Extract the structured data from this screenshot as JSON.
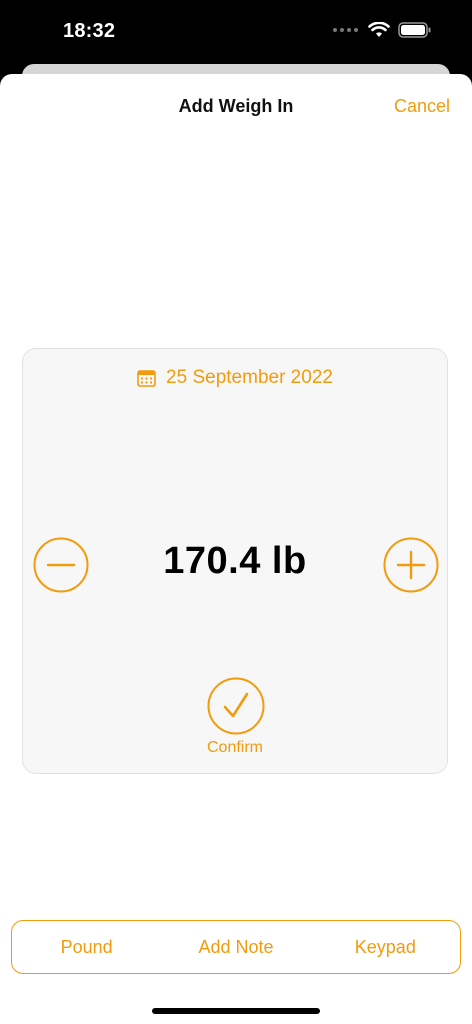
{
  "status_bar": {
    "time": "18:32"
  },
  "nav": {
    "title": "Add Weigh In",
    "cancel_label": "Cancel"
  },
  "entry": {
    "date": "25 September 2022",
    "weight": "170.4 lb",
    "confirm_label": "Confirm"
  },
  "bottom_bar": {
    "items": [
      {
        "label": "Pound"
      },
      {
        "label": "Add Note"
      },
      {
        "label": "Keypad"
      }
    ]
  },
  "colors": {
    "accent": "#f29b0c",
    "card_bg": "#f7f7f7"
  },
  "icons": [
    "calendar-icon",
    "minus-icon",
    "plus-icon",
    "checkmark-icon",
    "wifi-icon",
    "battery-icon",
    "cellular-dots-icon"
  ]
}
